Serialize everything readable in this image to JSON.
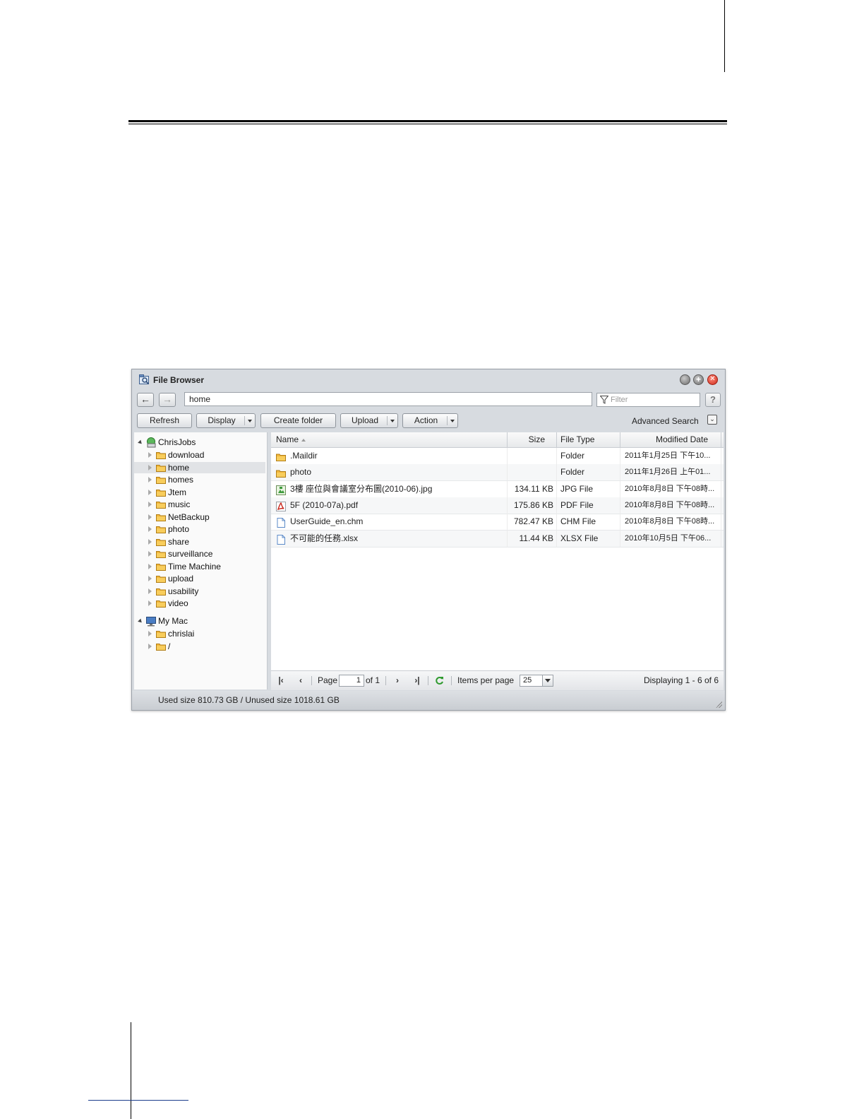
{
  "window": {
    "title": "File Browser",
    "path": "home",
    "filter_placeholder": "Filter",
    "help_label": "?"
  },
  "toolbar": {
    "refresh": "Refresh",
    "display": "Display",
    "create_folder": "Create folder",
    "upload": "Upload",
    "action": "Action",
    "advanced_search": "Advanced Search"
  },
  "tree": {
    "server": "ChrisJobs",
    "server_folders": [
      "download",
      "home",
      "homes",
      "Jtem",
      "music",
      "NetBackup",
      "photo",
      "share",
      "surveillance",
      "Time Machine",
      "upload",
      "usability",
      "video"
    ],
    "selected": "home",
    "local": "My Mac",
    "local_folders": [
      "chrislai",
      "/"
    ]
  },
  "grid": {
    "columns": [
      "Name",
      "Size",
      "File Type",
      "Modified Date"
    ],
    "rows": [
      {
        "icon": "folder-icon",
        "name": ".Maildir",
        "size": "",
        "type": "Folder",
        "date": "2011年1月25日 下午10..."
      },
      {
        "icon": "folder-icon",
        "name": "photo",
        "size": "",
        "type": "Folder",
        "date": "2011年1月26日 上午01..."
      },
      {
        "icon": "image-file-icon",
        "name": "3樓 座位與會議室分布圖(2010-06).jpg",
        "size": "134.11 KB",
        "type": "JPG File",
        "date": "2010年8月8日 下午08時..."
      },
      {
        "icon": "pdf-file-icon",
        "name": "5F (2010-07a).pdf",
        "size": "175.86 KB",
        "type": "PDF File",
        "date": "2010年8月8日 下午08時..."
      },
      {
        "icon": "document-file-icon",
        "name": "UserGuide_en.chm",
        "size": "782.47 KB",
        "type": "CHM File",
        "date": "2010年8月8日 下午08時..."
      },
      {
        "icon": "document-file-icon",
        "name": "不可能的任務.xlsx",
        "size": "11.44 KB",
        "type": "XLSX File",
        "date": "2010年10月5日 下午06..."
      }
    ]
  },
  "pager": {
    "page_label": "Page",
    "page_value": "1",
    "of_label": "of 1",
    "items_per_page_label": "Items per page",
    "items_per_page_value": "25",
    "displaying": "Displaying 1 - 6 of 6"
  },
  "status": {
    "usage": "Used size 810.73 GB / Unused size 1018.61 GB"
  },
  "colors": {
    "close_button": "#cc2a1a",
    "folder": "#f3b73a",
    "pdf_icon": "#c8251a",
    "refresh_icon": "#2f9a2f"
  }
}
